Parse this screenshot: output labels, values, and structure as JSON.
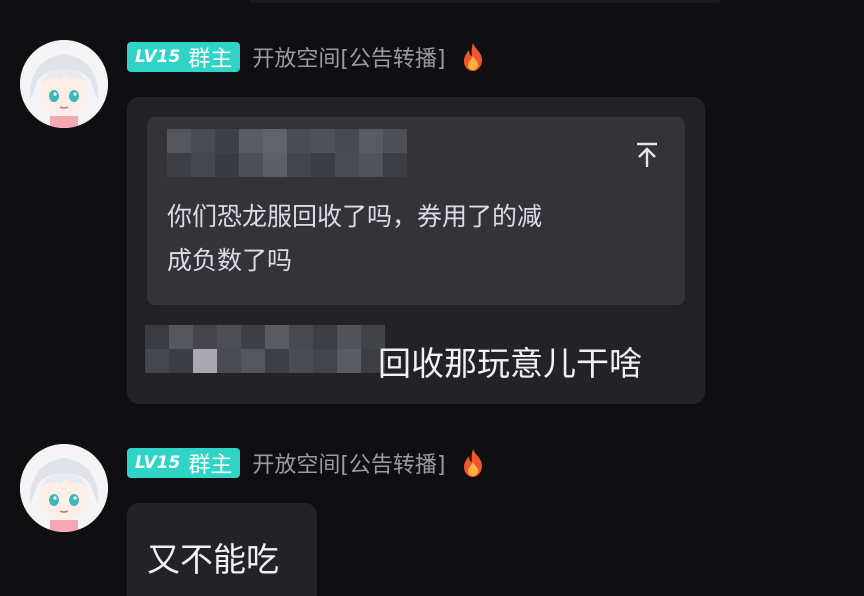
{
  "messages": [
    {
      "level_badge": "LV15",
      "role_badge": "群主",
      "space_name": "开放空间[公告转播]",
      "flame_icon": "flame-icon",
      "quoted_text_line1": "你们恐龙服回收了吗，券用了的减",
      "quoted_text_line2": "成负数了吗",
      "reply_text": "回收那玩意儿干啥"
    },
    {
      "level_badge": "LV15",
      "role_badge": "群主",
      "space_name": "开放空间[公告转播]",
      "flame_icon": "flame-icon",
      "text": "又不能吃"
    }
  ],
  "colors": {
    "background": "#0f0f12",
    "bubble": "#232327",
    "quote_box": "#333338",
    "badge": "#2fd4c6",
    "meta_text": "#9a9aa2"
  }
}
